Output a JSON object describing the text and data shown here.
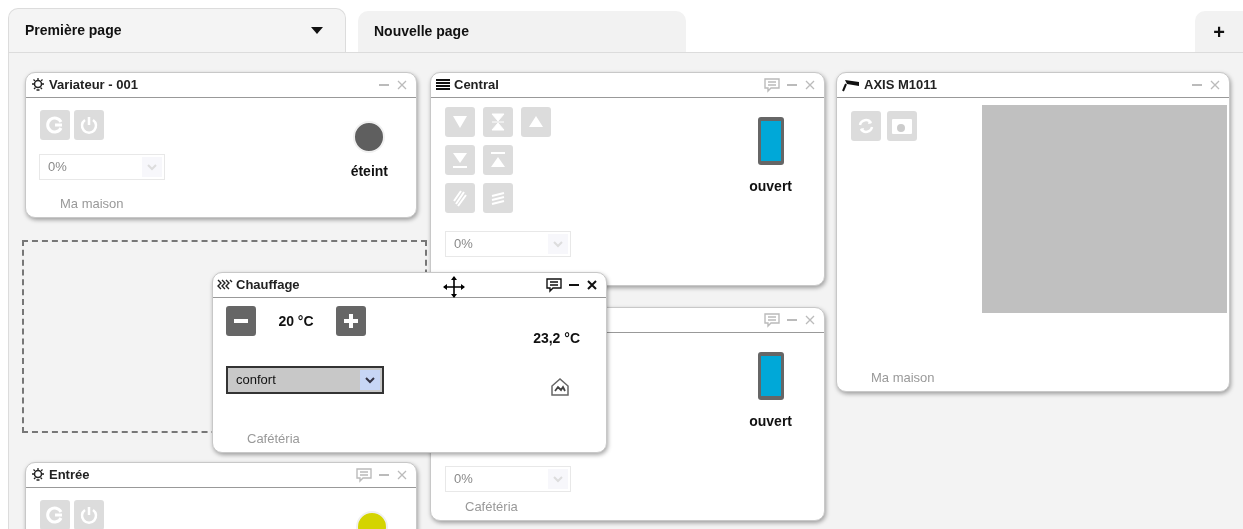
{
  "tabs": [
    {
      "label": "Première page",
      "selected": true,
      "menu": true
    },
    {
      "label": "Nouvelle page",
      "selected": false,
      "menu": false
    }
  ],
  "add_tab": "+",
  "widgets": [
    {
      "kind": "dimmer",
      "title": "Variateur - 001",
      "comment_button": false,
      "dragging": false,
      "level_value": "0%",
      "disabled": true,
      "color": "#5f5f5f",
      "status": "éteint",
      "location": "Ma maison"
    },
    {
      "kind": "shutter",
      "title": "Central",
      "comment_button": true,
      "dragging": false,
      "buttons_shown": true,
      "level_value": "0%",
      "disabled": true,
      "status": "ouvert"
    },
    {
      "kind": "camera",
      "title": "AXIS M1011",
      "comment_button": false,
      "dragging": false,
      "location": "Ma maison"
    },
    {
      "kind": "shutter",
      "comment_button": true,
      "dragging": false,
      "buttons_shown": false,
      "level_value": "0%",
      "disabled": true,
      "status": "ouvert",
      "location": "Cafétéria"
    },
    {
      "kind": "dimmer",
      "title": "Entrée",
      "comment_button": true,
      "dragging": false,
      "disabled": true,
      "color": "#d4d400"
    },
    {
      "kind": "heating",
      "title": "Chauffage",
      "comment_button": true,
      "dragging": true,
      "setpoint": "20 °C",
      "current": "23,2 °C",
      "mode": "confort",
      "disabled": false,
      "location": "Cafétéria"
    }
  ]
}
